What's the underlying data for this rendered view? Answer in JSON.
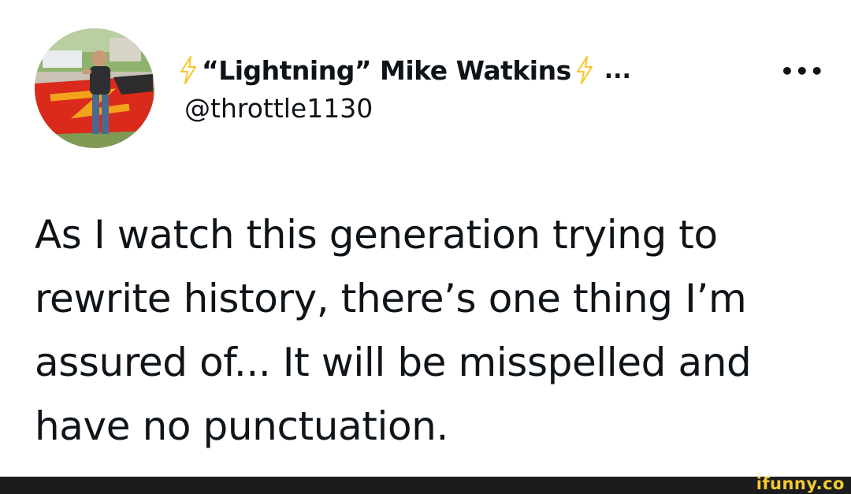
{
  "tweet": {
    "display_name": "“Lightning” Mike Watkins",
    "name_truncation": "...",
    "handle": "@throttle1130",
    "more_label": "•••",
    "text": "As I watch this generation trying to rewrite history, there’s one thing I’m assured of... It will be misspelled and have no punctuation.",
    "icons": {
      "name_prefix": "lightning-bolt-emoji",
      "name_suffix": "lightning-bolt-emoji"
    }
  },
  "footer": {
    "watermark": "ifunny.co"
  },
  "colors": {
    "text": "#0f1419",
    "background": "#ffffff",
    "bolt": "#f7c52a",
    "footer_bar": "#1c1c1e",
    "watermark": "#f3cb2f"
  }
}
